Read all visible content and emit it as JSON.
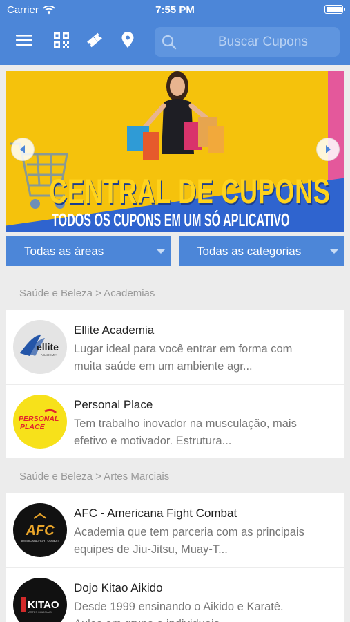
{
  "status_bar": {
    "carrier": "Carrier",
    "time": "7:55 PM"
  },
  "nav": {
    "search_placeholder": "Buscar Cupons"
  },
  "banner": {
    "title": "CENTRAL DE CUPONS",
    "subtitle": "TODOS OS CUPONS EM UM SÓ APLICATIVO"
  },
  "filters": {
    "area": "Todas as áreas",
    "category": "Todas as categorias"
  },
  "sections": [
    {
      "header": "Saúde e Beleza > Academias",
      "items": [
        {
          "name": "Ellite Academia",
          "desc_line1": "Lugar ideal para você entrar em forma com",
          "desc_line2": "muita saúde em um ambiente agr...",
          "logo_text": "ellite",
          "logo_sub": "ACADEMIA"
        },
        {
          "name": "Personal Place",
          "desc_line1": "Tem trabalho inovador na musculação, mais",
          "desc_line2": "efetivo e motivador. Estrutura...",
          "logo_text": "PERSONAL",
          "logo_sub": "PLACE"
        }
      ]
    },
    {
      "header": "Saúde e Beleza > Artes Marciais",
      "items": [
        {
          "name": "AFC - Americana Fight Combat",
          "desc_line1": "Academia que tem parceria com as principais",
          "desc_line2": "equipes de Jiu-Jitsu, Muay-T...",
          "logo_text": "AFC",
          "logo_sub": "AMERICANA FIGHT COMBAT"
        },
        {
          "name": "Dojo Kitao Aikido",
          "desc_line1": "Desde 1999 ensinando o Aikido e Karatê.",
          "desc_line2": "Aulas em grupo e individuais...",
          "logo_text": "KITAO",
          "logo_sub": "ARTES MARCIAIS"
        }
      ]
    }
  ],
  "colors": {
    "primary": "#4c86d8",
    "banner_yellow": "#f5c20c",
    "banner_blue": "#2f64cf"
  }
}
